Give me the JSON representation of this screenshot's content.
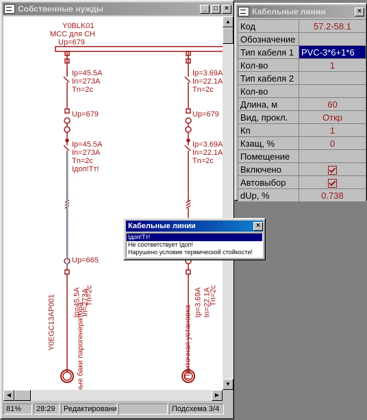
{
  "left_window": {
    "title": "Собственные нужды",
    "status": {
      "zoom": "81%",
      "time": "28:29",
      "mode": "Редактирование",
      "sheet": "Подсхема 3/4"
    }
  },
  "diagram": {
    "bus_name": "Y0BLK01",
    "bus_desc": "МСС для СН",
    "bus_up": "Up=679",
    "left_branch": {
      "ip1": "Ip=45.5A",
      "in1": "In=273A",
      "tn1": "Tn=2c",
      "up1": "Up=679",
      "ip2": "Ip=45.5A",
      "in2": "In=273A",
      "tn2": "Tn=2c",
      "warn": "Iдоп!Tт!",
      "up2": "Up=665",
      "v_name": "Y0EGC13AP001",
      "v_ip": "Ip=45.5A",
      "v_in": "In=273A",
      "v_tn": "Tn=2c",
      "load": "ходные баки парогенератора"
    },
    "right_branch": {
      "ip1": "Ip=3.69A",
      "in1": "In=22.1A",
      "tn1": "Tn=2c",
      "up1": "Up=679",
      "ip2": "Ip=3.69A",
      "in2": "In=22.1A",
      "tn2": "Tn=2c",
      "load": "Приточная установка",
      "v_ip": "Ip=3.69A",
      "v_in": "In=22.1A",
      "v_tn": "Tn=2c"
    }
  },
  "right_window": {
    "title": "Кабельные линии",
    "rows": [
      {
        "label": "Код",
        "value": "57.2-58.1"
      },
      {
        "label": "Обозначение",
        "value": ""
      },
      {
        "label": "Тип кабеля 1",
        "value": "PVC-3*6+1*6"
      },
      {
        "label": "Кол-во",
        "value": "1"
      },
      {
        "label": "Тип кабеля 2",
        "value": ""
      },
      {
        "label": "Кол-во",
        "value": ""
      },
      {
        "label": "Длина, м",
        "value": "60"
      },
      {
        "label": "Вид, прокл.",
        "value": "Откр"
      },
      {
        "label": "Кп",
        "value": "1"
      },
      {
        "label": "Кзащ, %",
        "value": "0"
      },
      {
        "label": "Помещение",
        "value": ""
      },
      {
        "label": "Включено",
        "value": "checked"
      },
      {
        "label": "Автовыбор",
        "value": "checked"
      },
      {
        "label": "dUp, %",
        "value": "0.738"
      }
    ]
  },
  "popup": {
    "title": "Кабельные линии",
    "items": [
      "Iдоп!Tт!",
      "Не соответствует Iдоп!",
      "Нарушено условие термической стойкости!"
    ]
  },
  "colors": {
    "diagram": "#a01818",
    "cable": "#80c8e0",
    "title_active": "#000080"
  },
  "icons": {
    "close": "×",
    "minimize": "_",
    "maximize": "□"
  }
}
